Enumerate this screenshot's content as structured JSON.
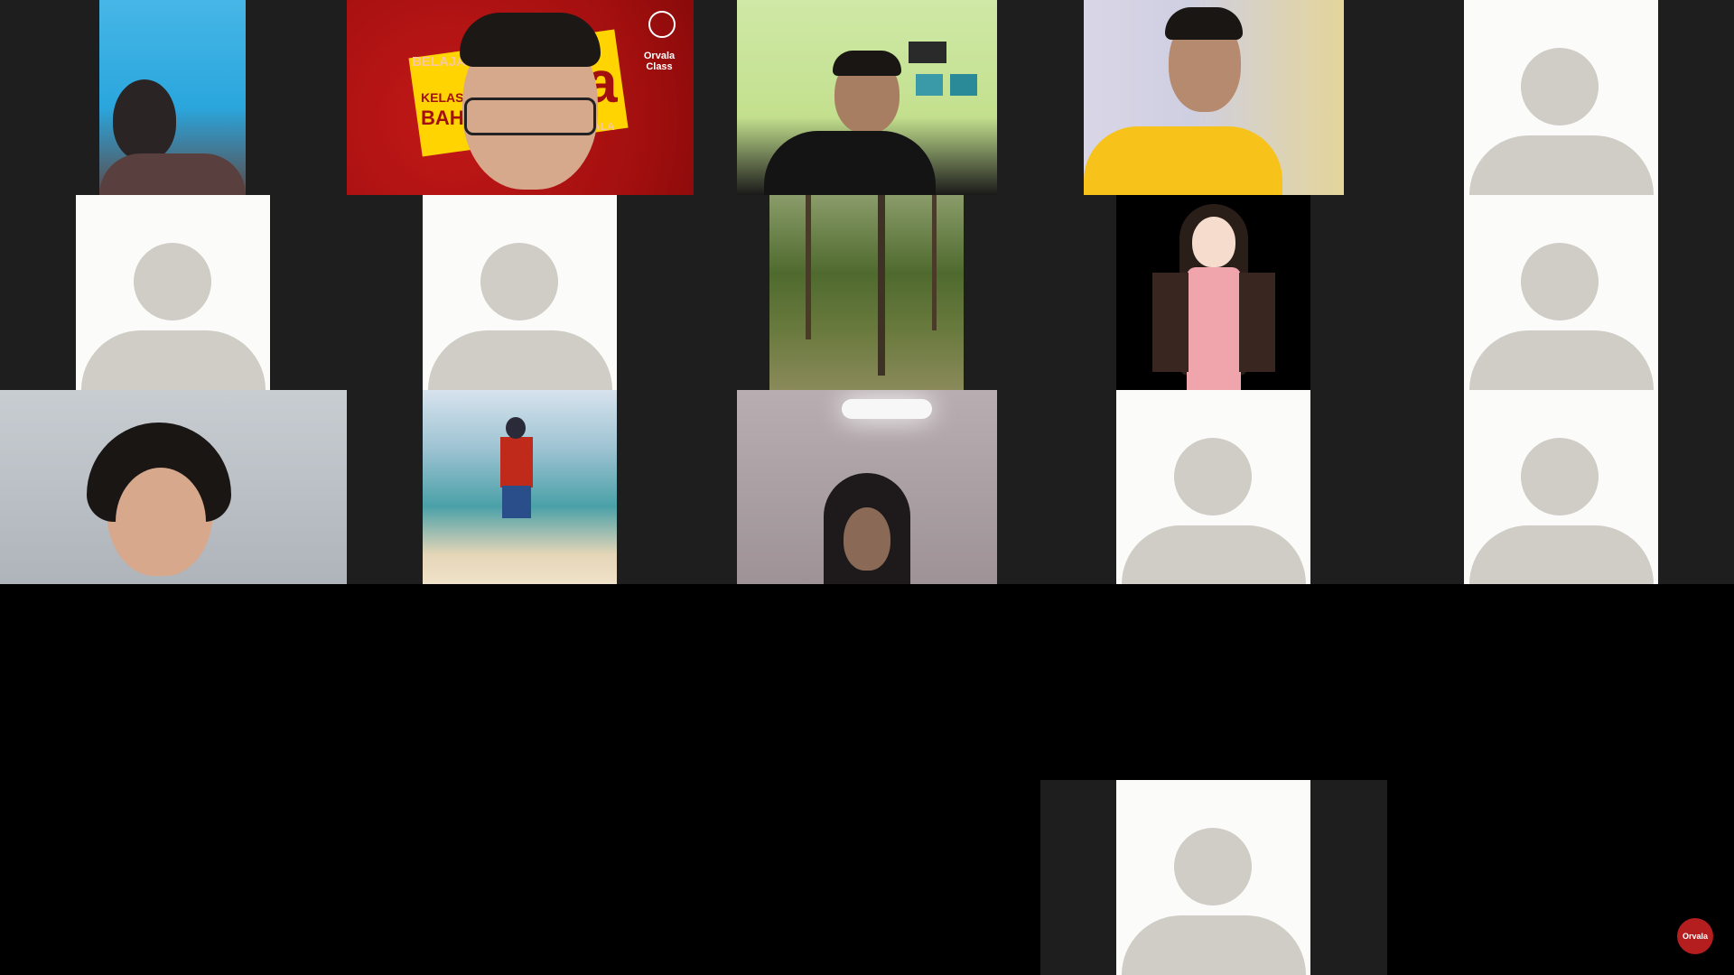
{
  "meeting": {
    "gallery": {
      "participants": [
        {
          "id": "p1",
          "kind": "video"
        },
        {
          "id": "p2",
          "kind": "video"
        },
        {
          "id": "p3",
          "kind": "video"
        },
        {
          "id": "p4",
          "kind": "video"
        },
        {
          "id": "p5",
          "kind": "avatar"
        },
        {
          "id": "p6",
          "kind": "avatar"
        },
        {
          "id": "p7",
          "kind": "avatar"
        },
        {
          "id": "p8",
          "kind": "video"
        },
        {
          "id": "p9",
          "kind": "video"
        },
        {
          "id": "p10",
          "kind": "avatar"
        },
        {
          "id": "p11",
          "kind": "video"
        },
        {
          "id": "p12",
          "kind": "video"
        },
        {
          "id": "p13",
          "kind": "video"
        },
        {
          "id": "p14",
          "kind": "avatar"
        },
        {
          "id": "p15",
          "kind": "avatar"
        },
        {
          "id": "p16",
          "kind": "avatar"
        }
      ]
    },
    "host_banner": {
      "line1": "BELAJAR",
      "line2": "KELAS",
      "line3": "BAH",
      "big_letter": "a",
      "trailing": "ALA",
      "brand_name": "Orvala",
      "brand_sub": "Class"
    },
    "watermark": {
      "label": "Orvala"
    },
    "colors": {
      "grid_background": "#1e1e1e",
      "stage_background": "#000000",
      "avatar_tile": "#fbfbf9",
      "avatar_silhouette": "#cfcdc6",
      "brand_red": "#b51e1e",
      "brand_yellow": "#ffd400"
    }
  }
}
